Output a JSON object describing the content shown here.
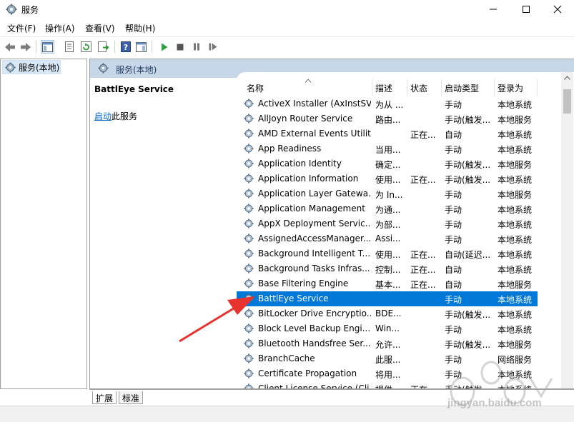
{
  "window": {
    "title": "服务"
  },
  "menu": [
    "文件(F)",
    "操作(A)",
    "查看(V)",
    "帮助(H)"
  ],
  "toolbar": {
    "icons": [
      "back-icon",
      "forward-icon",
      "show-hide-console-tree-icon",
      "properties-icon",
      "refresh-icon",
      "export-list-icon",
      "help-icon",
      "show-hide-action-pane-icon",
      "start-service-icon",
      "stop-service-icon",
      "pause-service-icon",
      "restart-service-icon"
    ]
  },
  "tree": {
    "item": "服务(本地)"
  },
  "panel": {
    "header": "服务(本地)",
    "selected_service": "BattlEye Service",
    "start_link": "启动",
    "start_suffix": "此服务"
  },
  "list": {
    "columns": [
      "名称",
      "描述",
      "状态",
      "启动类型",
      "登录为"
    ],
    "rows": [
      {
        "name": "ActiveX Installer (AxInstSV)",
        "desc": "为从 ...",
        "status": "",
        "startup": "手动",
        "logon": "本地系统"
      },
      {
        "name": "AllJoyn Router Service",
        "desc": "路由...",
        "status": "",
        "startup": "手动(触发...",
        "logon": "本地服务"
      },
      {
        "name": "AMD External Events Utility",
        "desc": "",
        "status": "正在...",
        "startup": "自动",
        "logon": "本地系统"
      },
      {
        "name": "App Readiness",
        "desc": "当用...",
        "status": "",
        "startup": "手动",
        "logon": "本地系统"
      },
      {
        "name": "Application Identity",
        "desc": "确定...",
        "status": "",
        "startup": "手动(触发...",
        "logon": "本地服务"
      },
      {
        "name": "Application Information",
        "desc": "使用...",
        "status": "正在...",
        "startup": "手动(触发...",
        "logon": "本地系统"
      },
      {
        "name": "Application Layer Gatewa...",
        "desc": "为 In...",
        "status": "",
        "startup": "手动",
        "logon": "本地服务"
      },
      {
        "name": "Application Management",
        "desc": "为通...",
        "status": "",
        "startup": "手动",
        "logon": "本地系统"
      },
      {
        "name": "AppX Deployment Servic...",
        "desc": "为部...",
        "status": "",
        "startup": "手动",
        "logon": "本地系统"
      },
      {
        "name": "AssignedAccessManager...",
        "desc": "Assi...",
        "status": "",
        "startup": "手动",
        "logon": "本地系统"
      },
      {
        "name": "Background Intelligent T...",
        "desc": "使用...",
        "status": "正在...",
        "startup": "自动(延迟...",
        "logon": "本地系统"
      },
      {
        "name": "Background Tasks Infras...",
        "desc": "控制...",
        "status": "正在...",
        "startup": "自动",
        "logon": "本地系统"
      },
      {
        "name": "Base Filtering Engine",
        "desc": "基本...",
        "status": "正在...",
        "startup": "自动",
        "logon": "本地服务"
      },
      {
        "name": "BattlEye Service",
        "desc": "",
        "status": "",
        "startup": "手动",
        "logon": "本地系统",
        "selected": true
      },
      {
        "name": "BitLocker Drive Encryptio...",
        "desc": "BDE...",
        "status": "",
        "startup": "手动(触发...",
        "logon": "本地系统"
      },
      {
        "name": "Block Level Backup Engi...",
        "desc": "Win...",
        "status": "",
        "startup": "手动",
        "logon": "本地系统"
      },
      {
        "name": "Bluetooth Handsfree Ser...",
        "desc": "允许...",
        "status": "",
        "startup": "手动(触发...",
        "logon": "本地服务"
      },
      {
        "name": "BranchCache",
        "desc": "此服...",
        "status": "",
        "startup": "手动",
        "logon": "网络服务"
      },
      {
        "name": "Certificate Propagation",
        "desc": "将用...",
        "status": "",
        "startup": "手动",
        "logon": "本地系统"
      },
      {
        "name": "Client License Service (Cli...",
        "desc": "提供...",
        "status": "正在...",
        "startup": "手动(触发...",
        "logon": "本地系统"
      }
    ]
  },
  "tabs": [
    "扩展",
    "标准"
  ],
  "watermark": "jingyan.baidu.com",
  "colors": {
    "selection": "#0078d7",
    "header_bg": "#c7d6e9",
    "link": "#0066cc",
    "arrow": "#e8322d"
  }
}
